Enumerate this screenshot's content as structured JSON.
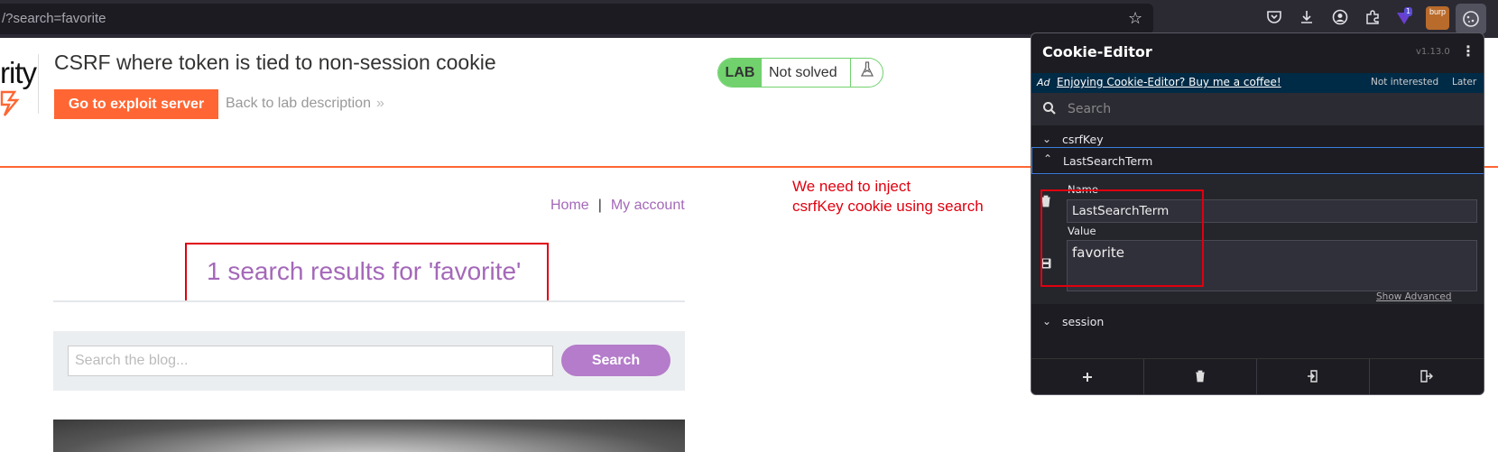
{
  "browser": {
    "url": "/?search=favorite",
    "toolbar_icons": [
      "bookmark-star-icon",
      "pocket-icon",
      "download-icon",
      "account-icon",
      "extensions-icon",
      "proxy-extension-icon",
      "burp-icon",
      "cookie-editor-icon"
    ],
    "extension_badge": "1",
    "burp_label": "burp"
  },
  "lab": {
    "logo_text": "rity",
    "title": "CSRF where token is tied to non-session cookie",
    "exploit_button": "Go to exploit server",
    "back_link": "Back to lab description",
    "back_chevron": "»",
    "badge_lab": "LAB",
    "badge_status": "Not solved",
    "flask_glyph": "⚗",
    "accent_orange": "#ff6633",
    "badge_green": "#70d16d"
  },
  "nav": {
    "home": "Home",
    "separator": "|",
    "account": "My account"
  },
  "results": {
    "heading": "1 search results for 'favorite'"
  },
  "blog_search": {
    "placeholder": "Search the blog...",
    "button": "Search"
  },
  "annotation": {
    "line1": "We need to inject",
    "line2": "csrfKey cookie using search"
  },
  "cookie_editor": {
    "title": "Cookie-Editor",
    "version": "v1.13.0",
    "ad_tag": "Ad",
    "ad_text": "Enjoying Cookie-Editor? Buy me a coffee!",
    "ad_dismiss": "Not interested",
    "ad_later": "Later",
    "search_placeholder": "Search",
    "cookies": [
      {
        "name": "csrfKey",
        "expanded": false
      },
      {
        "name": "LastSearchTerm",
        "expanded": true
      },
      {
        "name": "session",
        "expanded": false
      }
    ],
    "detail": {
      "name_label": "Name",
      "name_value": "LastSearchTerm",
      "value_label": "Value",
      "value_value": "favorite",
      "show_advanced": "Show Advanced"
    },
    "footer_buttons": [
      "add-icon",
      "delete-all-icon",
      "import-icon",
      "export-icon"
    ]
  }
}
